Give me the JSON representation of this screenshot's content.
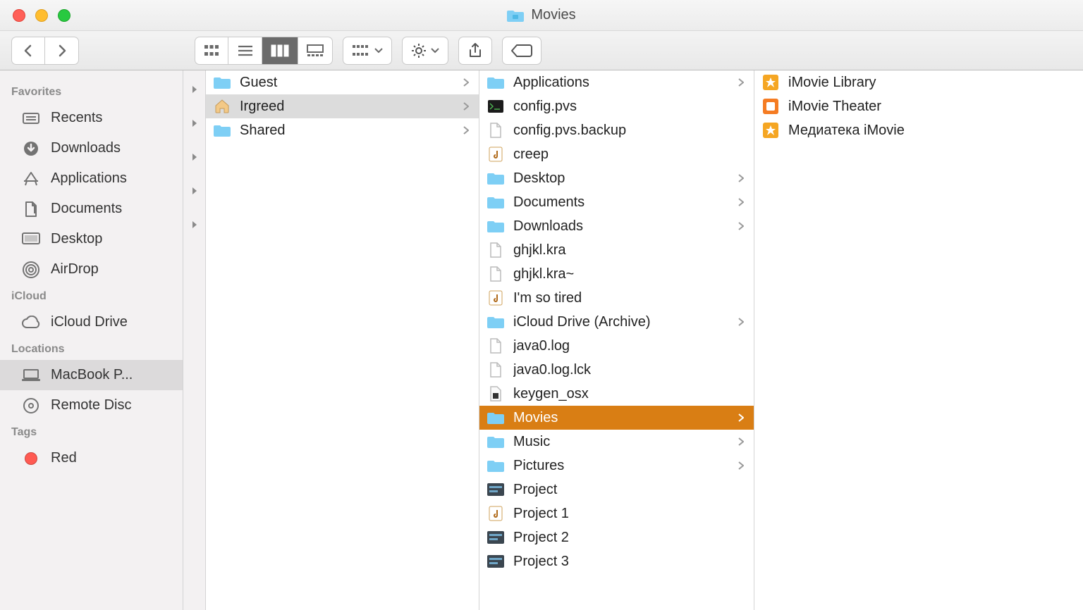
{
  "window": {
    "title": "Movies"
  },
  "sidebar": {
    "sections": [
      {
        "header": "Favorites",
        "items": [
          {
            "label": "Recents",
            "icon": "recents"
          },
          {
            "label": "Downloads",
            "icon": "downloads"
          },
          {
            "label": "Applications",
            "icon": "applications"
          },
          {
            "label": "Documents",
            "icon": "documents"
          },
          {
            "label": "Desktop",
            "icon": "desktop"
          },
          {
            "label": "AirDrop",
            "icon": "airdrop"
          }
        ]
      },
      {
        "header": "iCloud",
        "items": [
          {
            "label": "iCloud Drive",
            "icon": "cloud"
          }
        ]
      },
      {
        "header": "Locations",
        "items": [
          {
            "label": "MacBook P...",
            "icon": "laptop",
            "selected": true
          },
          {
            "label": "Remote Disc",
            "icon": "disc"
          }
        ]
      },
      {
        "header": "Tags",
        "items": [
          {
            "label": "Red",
            "icon": "tag",
            "color": "#ff5a52"
          }
        ]
      }
    ]
  },
  "columns": {
    "handles_count": 5,
    "c1": [
      {
        "label": "Guest",
        "icon": "folder",
        "has_children": true
      },
      {
        "label": "Irgreed",
        "icon": "home",
        "has_children": true,
        "selected": "grey"
      },
      {
        "label": "Shared",
        "icon": "folder",
        "has_children": true
      }
    ],
    "c2": [
      {
        "label": "Applications",
        "icon": "folder-app",
        "has_children": true
      },
      {
        "label": "config.pvs",
        "icon": "terminal"
      },
      {
        "label": "config.pvs.backup",
        "icon": "file"
      },
      {
        "label": "creep",
        "icon": "music-doc"
      },
      {
        "label": "Desktop",
        "icon": "folder",
        "has_children": true
      },
      {
        "label": "Documents",
        "icon": "folder",
        "has_children": true
      },
      {
        "label": "Downloads",
        "icon": "folder-dl",
        "has_children": true
      },
      {
        "label": "ghjkl.kra",
        "icon": "file"
      },
      {
        "label": "ghjkl.kra~",
        "icon": "file"
      },
      {
        "label": "I'm so tired",
        "icon": "music-doc"
      },
      {
        "label": "iCloud Drive (Archive)",
        "icon": "folder",
        "has_children": true
      },
      {
        "label": "java0.log",
        "icon": "file"
      },
      {
        "label": "java0.log.lck",
        "icon": "file"
      },
      {
        "label": "keygen_osx",
        "icon": "exec"
      },
      {
        "label": "Movies",
        "icon": "folder-movie",
        "has_children": true,
        "selected": "orange"
      },
      {
        "label": "Music",
        "icon": "folder-music",
        "has_children": true
      },
      {
        "label": "Pictures",
        "icon": "folder-pic",
        "has_children": true
      },
      {
        "label": "Project",
        "icon": "garageband"
      },
      {
        "label": "Project 1",
        "icon": "music-doc"
      },
      {
        "label": "Project 2",
        "icon": "garageband"
      },
      {
        "label": "Project 3",
        "icon": "garageband"
      }
    ],
    "c3": [
      {
        "label": "iMovie Library",
        "icon": "imovie-lib"
      },
      {
        "label": "iMovie Theater",
        "icon": "imovie-theater"
      },
      {
        "label": "Медиатека iMovie",
        "icon": "imovie-lib"
      }
    ]
  }
}
